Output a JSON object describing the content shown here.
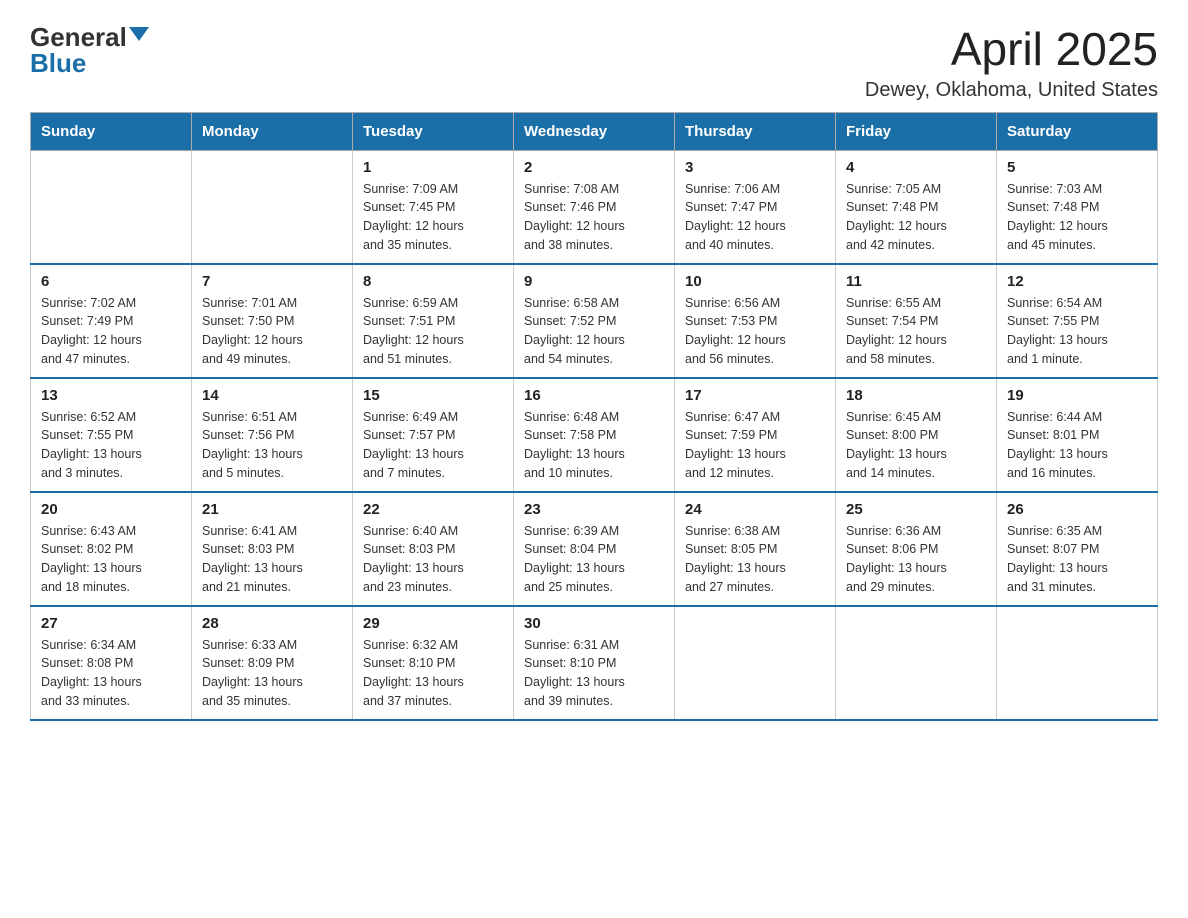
{
  "header": {
    "logo_general": "General",
    "logo_blue": "Blue",
    "month_title": "April 2025",
    "location": "Dewey, Oklahoma, United States"
  },
  "days_of_week": [
    "Sunday",
    "Monday",
    "Tuesday",
    "Wednesday",
    "Thursday",
    "Friday",
    "Saturday"
  ],
  "weeks": [
    [
      {
        "day": "",
        "info": ""
      },
      {
        "day": "",
        "info": ""
      },
      {
        "day": "1",
        "info": "Sunrise: 7:09 AM\nSunset: 7:45 PM\nDaylight: 12 hours\nand 35 minutes."
      },
      {
        "day": "2",
        "info": "Sunrise: 7:08 AM\nSunset: 7:46 PM\nDaylight: 12 hours\nand 38 minutes."
      },
      {
        "day": "3",
        "info": "Sunrise: 7:06 AM\nSunset: 7:47 PM\nDaylight: 12 hours\nand 40 minutes."
      },
      {
        "day": "4",
        "info": "Sunrise: 7:05 AM\nSunset: 7:48 PM\nDaylight: 12 hours\nand 42 minutes."
      },
      {
        "day": "5",
        "info": "Sunrise: 7:03 AM\nSunset: 7:48 PM\nDaylight: 12 hours\nand 45 minutes."
      }
    ],
    [
      {
        "day": "6",
        "info": "Sunrise: 7:02 AM\nSunset: 7:49 PM\nDaylight: 12 hours\nand 47 minutes."
      },
      {
        "day": "7",
        "info": "Sunrise: 7:01 AM\nSunset: 7:50 PM\nDaylight: 12 hours\nand 49 minutes."
      },
      {
        "day": "8",
        "info": "Sunrise: 6:59 AM\nSunset: 7:51 PM\nDaylight: 12 hours\nand 51 minutes."
      },
      {
        "day": "9",
        "info": "Sunrise: 6:58 AM\nSunset: 7:52 PM\nDaylight: 12 hours\nand 54 minutes."
      },
      {
        "day": "10",
        "info": "Sunrise: 6:56 AM\nSunset: 7:53 PM\nDaylight: 12 hours\nand 56 minutes."
      },
      {
        "day": "11",
        "info": "Sunrise: 6:55 AM\nSunset: 7:54 PM\nDaylight: 12 hours\nand 58 minutes."
      },
      {
        "day": "12",
        "info": "Sunrise: 6:54 AM\nSunset: 7:55 PM\nDaylight: 13 hours\nand 1 minute."
      }
    ],
    [
      {
        "day": "13",
        "info": "Sunrise: 6:52 AM\nSunset: 7:55 PM\nDaylight: 13 hours\nand 3 minutes."
      },
      {
        "day": "14",
        "info": "Sunrise: 6:51 AM\nSunset: 7:56 PM\nDaylight: 13 hours\nand 5 minutes."
      },
      {
        "day": "15",
        "info": "Sunrise: 6:49 AM\nSunset: 7:57 PM\nDaylight: 13 hours\nand 7 minutes."
      },
      {
        "day": "16",
        "info": "Sunrise: 6:48 AM\nSunset: 7:58 PM\nDaylight: 13 hours\nand 10 minutes."
      },
      {
        "day": "17",
        "info": "Sunrise: 6:47 AM\nSunset: 7:59 PM\nDaylight: 13 hours\nand 12 minutes."
      },
      {
        "day": "18",
        "info": "Sunrise: 6:45 AM\nSunset: 8:00 PM\nDaylight: 13 hours\nand 14 minutes."
      },
      {
        "day": "19",
        "info": "Sunrise: 6:44 AM\nSunset: 8:01 PM\nDaylight: 13 hours\nand 16 minutes."
      }
    ],
    [
      {
        "day": "20",
        "info": "Sunrise: 6:43 AM\nSunset: 8:02 PM\nDaylight: 13 hours\nand 18 minutes."
      },
      {
        "day": "21",
        "info": "Sunrise: 6:41 AM\nSunset: 8:03 PM\nDaylight: 13 hours\nand 21 minutes."
      },
      {
        "day": "22",
        "info": "Sunrise: 6:40 AM\nSunset: 8:03 PM\nDaylight: 13 hours\nand 23 minutes."
      },
      {
        "day": "23",
        "info": "Sunrise: 6:39 AM\nSunset: 8:04 PM\nDaylight: 13 hours\nand 25 minutes."
      },
      {
        "day": "24",
        "info": "Sunrise: 6:38 AM\nSunset: 8:05 PM\nDaylight: 13 hours\nand 27 minutes."
      },
      {
        "day": "25",
        "info": "Sunrise: 6:36 AM\nSunset: 8:06 PM\nDaylight: 13 hours\nand 29 minutes."
      },
      {
        "day": "26",
        "info": "Sunrise: 6:35 AM\nSunset: 8:07 PM\nDaylight: 13 hours\nand 31 minutes."
      }
    ],
    [
      {
        "day": "27",
        "info": "Sunrise: 6:34 AM\nSunset: 8:08 PM\nDaylight: 13 hours\nand 33 minutes."
      },
      {
        "day": "28",
        "info": "Sunrise: 6:33 AM\nSunset: 8:09 PM\nDaylight: 13 hours\nand 35 minutes."
      },
      {
        "day": "29",
        "info": "Sunrise: 6:32 AM\nSunset: 8:10 PM\nDaylight: 13 hours\nand 37 minutes."
      },
      {
        "day": "30",
        "info": "Sunrise: 6:31 AM\nSunset: 8:10 PM\nDaylight: 13 hours\nand 39 minutes."
      },
      {
        "day": "",
        "info": ""
      },
      {
        "day": "",
        "info": ""
      },
      {
        "day": "",
        "info": ""
      }
    ]
  ]
}
